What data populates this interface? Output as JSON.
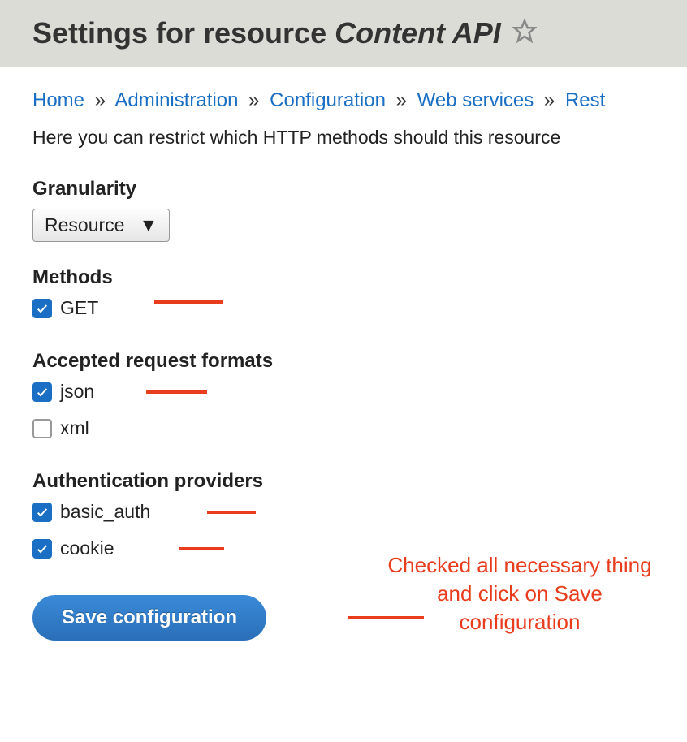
{
  "header": {
    "title_prefix": "Settings for resource ",
    "title_emphasis": "Content API"
  },
  "breadcrumb": {
    "items": [
      "Home",
      "Administration",
      "Configuration",
      "Web services",
      "Rest"
    ],
    "separator": "»"
  },
  "intro": "Here you can restrict which HTTP methods should this resource",
  "sections": {
    "granularity": {
      "label": "Granularity",
      "value": "Resource"
    },
    "methods": {
      "label": "Methods",
      "items": [
        {
          "label": "GET",
          "checked": true
        }
      ]
    },
    "formats": {
      "label": "Accepted request formats",
      "items": [
        {
          "label": "json",
          "checked": true
        },
        {
          "label": "xml",
          "checked": false
        }
      ]
    },
    "auth": {
      "label": "Authentication providers",
      "items": [
        {
          "label": "basic_auth",
          "checked": true
        },
        {
          "label": "cookie",
          "checked": true
        }
      ]
    }
  },
  "button": {
    "save": "Save configuration"
  },
  "annotation": {
    "line1": "Checked all necessary thing",
    "line2": "and click on Save",
    "line3": "configuration"
  }
}
